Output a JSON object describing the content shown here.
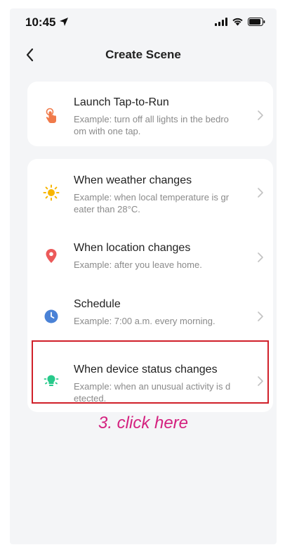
{
  "status_bar": {
    "time": "10:45"
  },
  "header": {
    "title": "Create Scene"
  },
  "tap_to_run": {
    "title": "Launch Tap-to-Run",
    "desc_line1": "Example: turn off all lights in the bedro",
    "desc_line2": "om with one tap."
  },
  "conditions": [
    {
      "title": "When weather changes",
      "desc_line1": "Example: when local temperature is gr",
      "desc_line2": "eater than 28°C."
    },
    {
      "title": "When location changes",
      "desc_line1": "Example: after you leave home.",
      "desc_line2": ""
    },
    {
      "title": "Schedule",
      "desc_line1": "Example: 7:00 a.m. every morning.",
      "desc_line2": ""
    },
    {
      "title": "When device status changes",
      "desc_line1": "Example: when an unusual activity is d",
      "desc_line2": "etected."
    }
  ],
  "annotation": {
    "text": "3. click here",
    "color": "#d4217f"
  },
  "colors": {
    "background": "#f4f5f7",
    "tap_icon": "#f07a4a",
    "weather_icon": "#f7b500",
    "location_icon": "#ec5a5a",
    "schedule_icon": "#4a82d6",
    "device_icon": "#27c98a",
    "highlight_border": "#d0202a"
  },
  "icons": [
    "back-chevron-icon",
    "tap-hand-icon",
    "sun-icon",
    "location-pin-icon",
    "clock-icon",
    "device-bulb-icon",
    "chevron-right-icon"
  ]
}
